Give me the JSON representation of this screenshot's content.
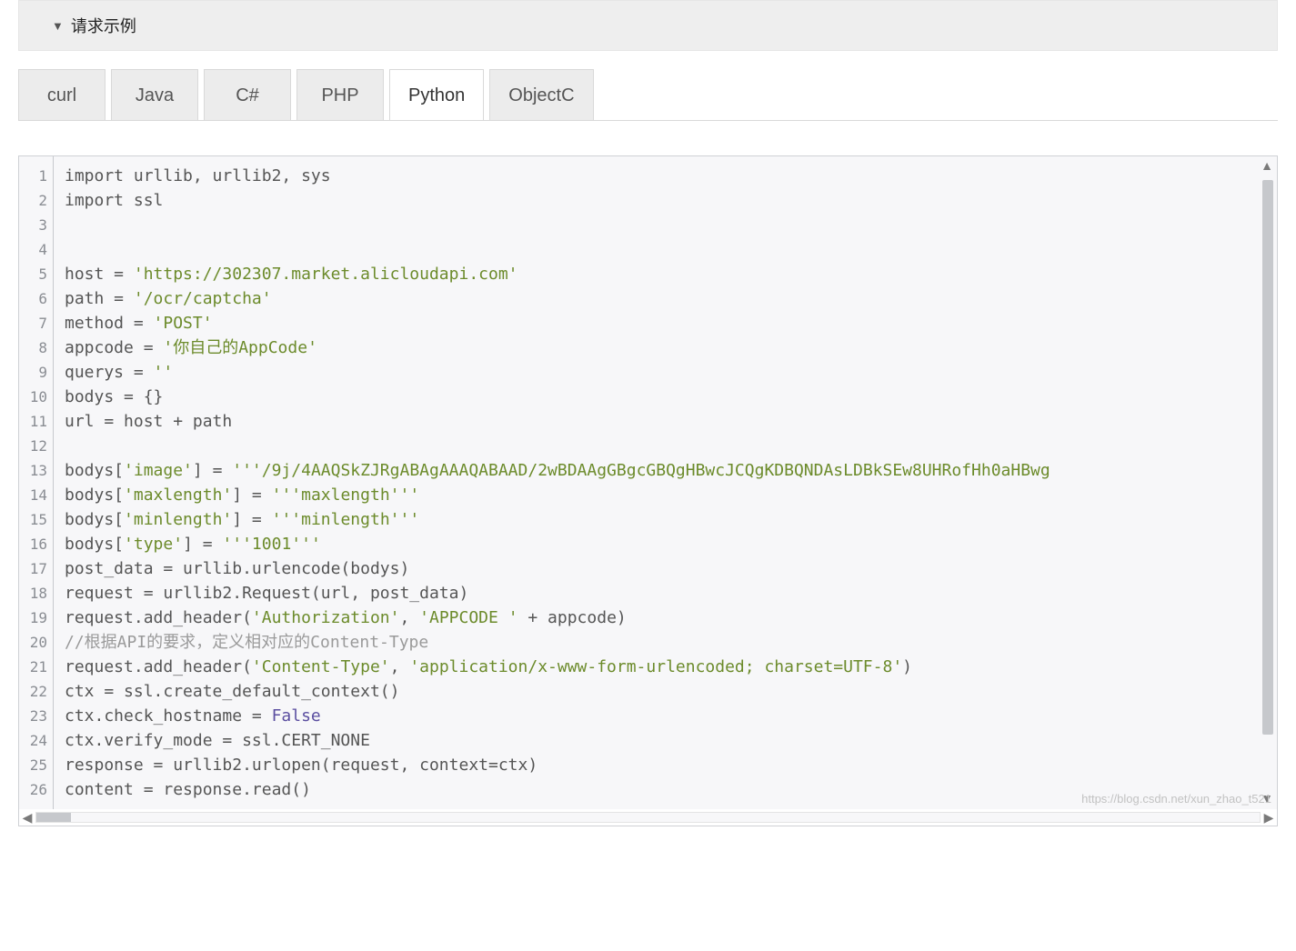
{
  "header": {
    "title": "请求示例"
  },
  "tabs": {
    "items": [
      {
        "label": "curl",
        "active": false
      },
      {
        "label": "Java",
        "active": false
      },
      {
        "label": "C#",
        "active": false
      },
      {
        "label": "PHP",
        "active": false
      },
      {
        "label": "Python",
        "active": true
      },
      {
        "label": "ObjectC",
        "active": false
      }
    ]
  },
  "code": {
    "line_count": 26,
    "tokens": [
      [
        {
          "t": "import urllib, urllib2, sys"
        }
      ],
      [
        {
          "t": "import ssl"
        }
      ],
      [
        {
          "t": ""
        }
      ],
      [
        {
          "t": ""
        }
      ],
      [
        {
          "t": "host = "
        },
        {
          "t": "'https://302307.market.alicloudapi.com'",
          "cls": "s"
        }
      ],
      [
        {
          "t": "path = "
        },
        {
          "t": "'/ocr/captcha'",
          "cls": "s"
        }
      ],
      [
        {
          "t": "method = "
        },
        {
          "t": "'POST'",
          "cls": "s"
        }
      ],
      [
        {
          "t": "appcode = "
        },
        {
          "t": "'你自己的AppCode'",
          "cls": "s"
        }
      ],
      [
        {
          "t": "querys = "
        },
        {
          "t": "''",
          "cls": "s"
        }
      ],
      [
        {
          "t": "bodys = {}"
        }
      ],
      [
        {
          "t": "url = host + path"
        }
      ],
      [
        {
          "t": ""
        }
      ],
      [
        {
          "t": "bodys["
        },
        {
          "t": "'image'",
          "cls": "s"
        },
        {
          "t": "] = "
        },
        {
          "t": "'''/9j/4AAQSkZJRgABAgAAAQABAAD/2wBDAAgGBgcGBQgHBwcJCQgKDBQNDAsLDBkSEw8UHRofHh0aHBwg",
          "cls": "s"
        }
      ],
      [
        {
          "t": "bodys["
        },
        {
          "t": "'maxlength'",
          "cls": "s"
        },
        {
          "t": "] = "
        },
        {
          "t": "'''maxlength'''",
          "cls": "s"
        }
      ],
      [
        {
          "t": "bodys["
        },
        {
          "t": "'minlength'",
          "cls": "s"
        },
        {
          "t": "] = "
        },
        {
          "t": "'''minlength'''",
          "cls": "s"
        }
      ],
      [
        {
          "t": "bodys["
        },
        {
          "t": "'type'",
          "cls": "s"
        },
        {
          "t": "] = "
        },
        {
          "t": "'''1001'''",
          "cls": "s"
        }
      ],
      [
        {
          "t": "post_data = urllib.urlencode(bodys)"
        }
      ],
      [
        {
          "t": "request = urllib2.Request(url, post_data)"
        }
      ],
      [
        {
          "t": "request.add_header("
        },
        {
          "t": "'Authorization'",
          "cls": "s"
        },
        {
          "t": ", "
        },
        {
          "t": "'APPCODE '",
          "cls": "s"
        },
        {
          "t": " + appcode)"
        }
      ],
      [
        {
          "t": "//根据API的要求，定义相对应的Content-Type",
          "cls": "c"
        }
      ],
      [
        {
          "t": "request.add_header("
        },
        {
          "t": "'Content-Type'",
          "cls": "s"
        },
        {
          "t": ", "
        },
        {
          "t": "'application/x-www-form-urlencoded; charset=UTF-8'",
          "cls": "s"
        },
        {
          "t": ")"
        }
      ],
      [
        {
          "t": "ctx = ssl.create_default_context()"
        }
      ],
      [
        {
          "t": "ctx.check_hostname = "
        },
        {
          "t": "False",
          "cls": "k"
        }
      ],
      [
        {
          "t": "ctx.verify_mode = ssl.CERT_NONE"
        }
      ],
      [
        {
          "t": "response = urllib2.urlopen(request, context=ctx)"
        }
      ],
      [
        {
          "t": "content = response.read()"
        }
      ]
    ]
  },
  "watermark": "https://blog.csdn.net/xun_zhao_t521"
}
